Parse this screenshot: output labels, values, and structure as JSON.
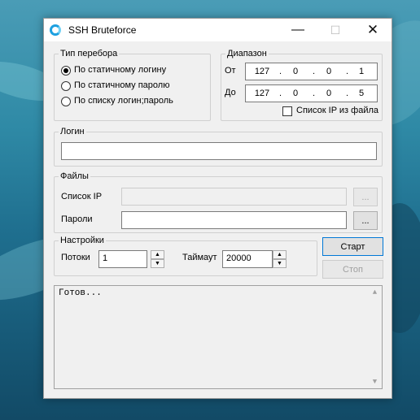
{
  "window": {
    "title": "SSH Bruteforce",
    "minimize": "—",
    "maximize": "☐",
    "close": "✕"
  },
  "mode_group": {
    "legend": "Тип перебора",
    "options": [
      {
        "label": "По статичному логину",
        "checked": true
      },
      {
        "label": "По статичному паролю",
        "checked": false
      },
      {
        "label": "По списку логин;пароль",
        "checked": false
      }
    ]
  },
  "range_group": {
    "legend": "Диапазон",
    "from_label": "От",
    "to_label": "До",
    "from_ip": [
      "127",
      "0",
      "0",
      "1"
    ],
    "to_ip": [
      "127",
      "0",
      "0",
      "5"
    ],
    "ip_from_file_label": "Список IP из файла"
  },
  "login_group": {
    "legend": "Логин",
    "value": ""
  },
  "files_group": {
    "legend": "Файлы",
    "ip_list_label": "Список IP",
    "ip_list_value": "",
    "passwords_label": "Пароли",
    "passwords_value": "",
    "browse_label": "..."
  },
  "settings_group": {
    "legend": "Настройки",
    "threads_label": "Потоки",
    "threads_value": "1",
    "timeout_label": "Таймаут",
    "timeout_value": "20000"
  },
  "actions": {
    "start": "Старт",
    "stop": "Стоп"
  },
  "log": {
    "text": "Готов..."
  },
  "glyphs": {
    "spin_up": "▲",
    "spin_down": "▼",
    "dot": "."
  }
}
